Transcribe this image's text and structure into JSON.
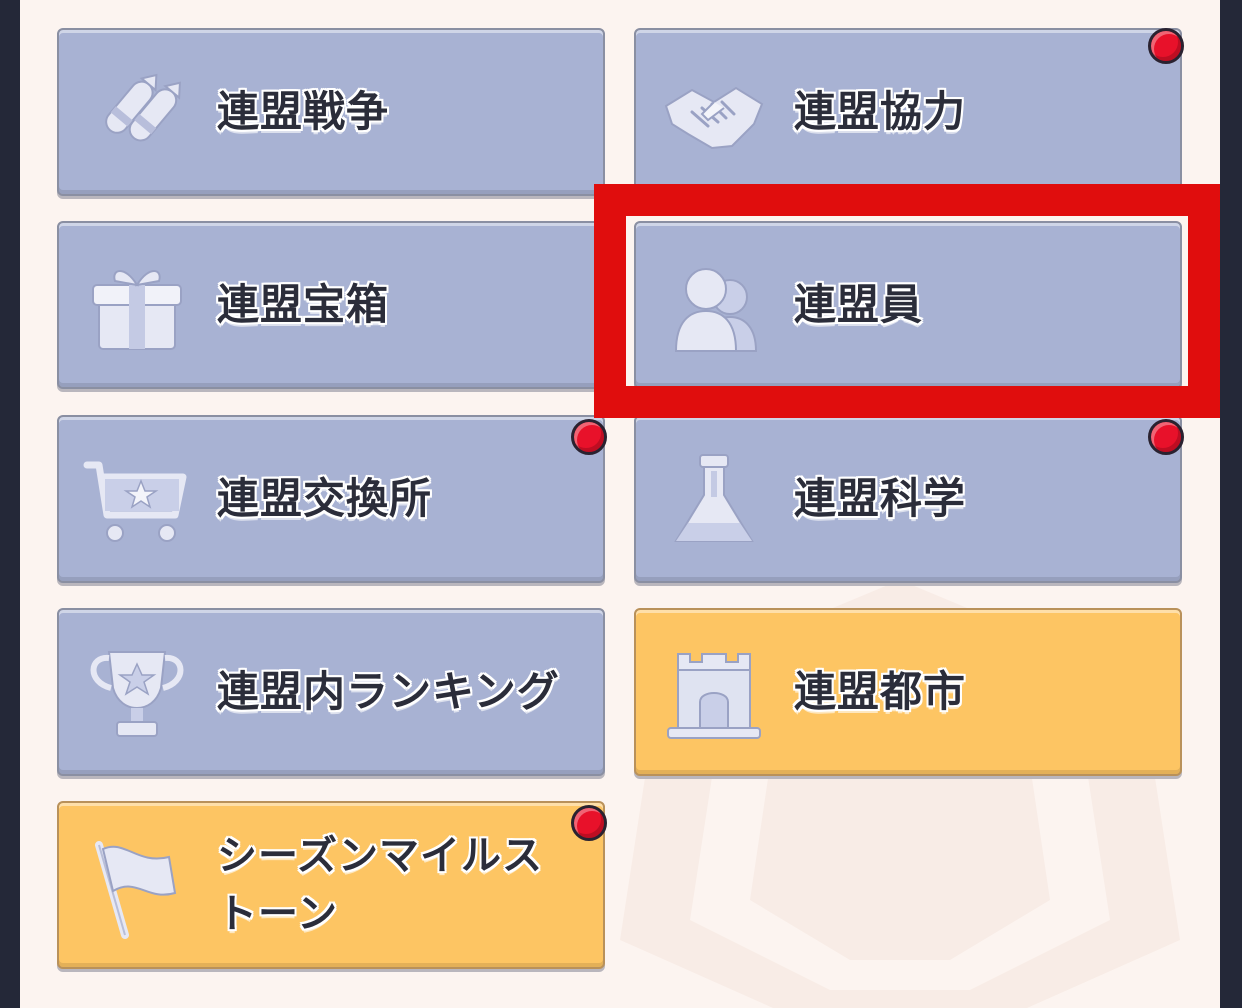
{
  "buttons": [
    {
      "label": "連盟戦争",
      "icon": "missiles-icon"
    },
    {
      "label": "連盟協力",
      "icon": "handshake-icon"
    },
    {
      "label": "連盟宝箱",
      "icon": "gift-icon"
    },
    {
      "label": "連盟員",
      "icon": "members-icon"
    },
    {
      "label": "連盟交換所",
      "icon": "cart-icon"
    },
    {
      "label": "連盟科学",
      "icon": "flask-icon"
    },
    {
      "label": "連盟内ランキング",
      "icon": "trophy-icon"
    },
    {
      "label": "連盟都市",
      "icon": "castle-icon"
    },
    {
      "label": "シーズンマイルス\nトーン",
      "icon": "flag-icon"
    }
  ],
  "colors": {
    "button_blue": "#a8b2d3",
    "button_gold": "#fdc563",
    "notification_dot": "#e8112a",
    "highlight_frame": "#e00d0d",
    "panel_background": "#fcf4f0"
  }
}
